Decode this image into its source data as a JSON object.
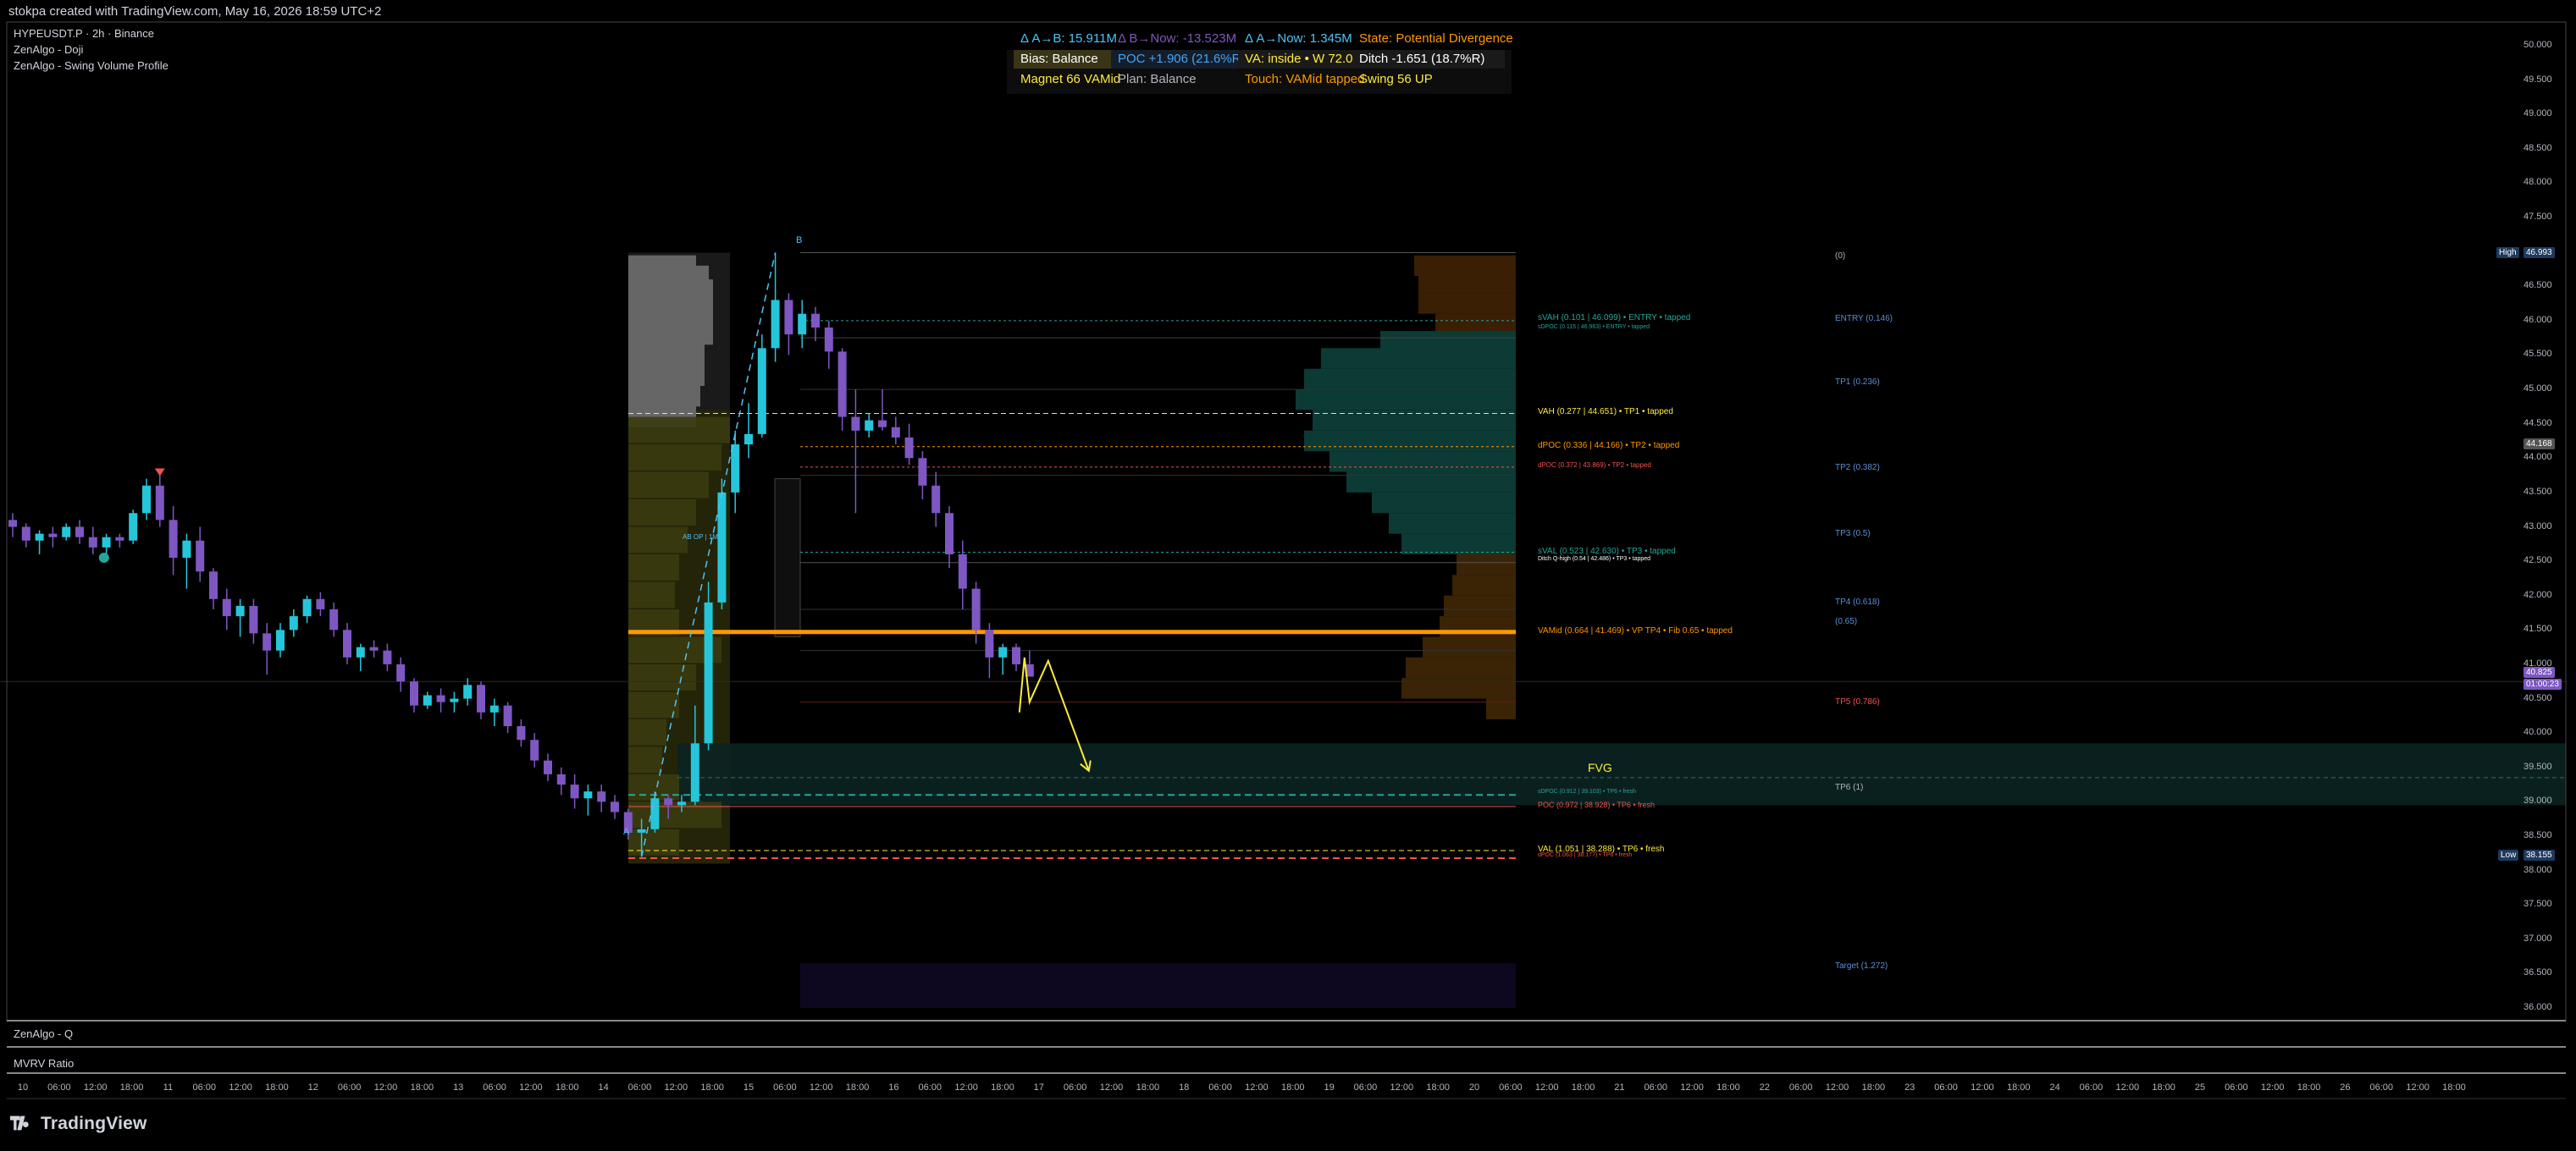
{
  "header": {
    "title": "stokpa created with TradingView.com, May 16, 2026 18:59 UTC+2"
  },
  "legend": [
    "HYPEUSDT.P · 2h · Binance",
    "ZenAlgo - Doji",
    "ZenAlgo - Swing Volume Profile"
  ],
  "stats": {
    "row1": [
      {
        "text": "Δ A→B: 15.911M",
        "color": "#4fc3f7"
      },
      {
        "text": "Δ B→Now: -13.523M",
        "color": "#7e57c2"
      },
      {
        "text": "Δ A→Now: 1.345M",
        "color": "#4fc3f7"
      },
      {
        "text": "State: Potential Divergence",
        "color": "#ff9800"
      }
    ],
    "row2": [
      {
        "text": "Bias: Balance",
        "color": "#ffffff"
      },
      {
        "text": "POC +1.906 (21.6%R)",
        "color": "#42a5f5"
      },
      {
        "text": "VA: inside • W 72.0%R",
        "color": "#ffeb3b"
      },
      {
        "text": "Ditch -1.651 (18.7%R)",
        "color": "#ffffff"
      }
    ],
    "row3": [
      {
        "text": "Magnet 66 VAMid",
        "color": "#ffeb3b"
      },
      {
        "text": "Plan: Balance",
        "color": "#b2b5be"
      },
      {
        "text": "Touch: VAMid tapped",
        "color": "#ff9800"
      },
      {
        "text": "Swing 56 UP",
        "color": "#ffeb3b"
      }
    ]
  },
  "levels": [
    {
      "text": "sVAH (0.101 | 46.099) • ENTRY • tapped",
      "color": "#26a69a"
    },
    {
      "text": "sDPOC (0.115 | 46.963) • ENTRY • tapped",
      "color": "#26a69a"
    },
    {
      "text": "VAH (0.277 | 44.651) • TP1 • tapped",
      "color": "#ffeb3b"
    },
    {
      "text": "dPOC (0.336 | 44.166) • TP2 • tapped",
      "color": "#ff9800"
    },
    {
      "text": "dPOC (0.372 | 43.869) • TP2 • tapped",
      "color": "#ef5350"
    },
    {
      "text": "sVAL (0.523 | 42.630) • TP3 • tapped",
      "color": "#26a69a"
    },
    {
      "text": "Ditch Q-high (0.54 | 42.486) • TP3 • tapped",
      "color": "#ffffff"
    },
    {
      "text": "VAMid (0.664 | 41.469) • VP TP4 • Fib 0.65 • tapped",
      "color": "#ff9800"
    },
    {
      "text": "sDPOC (0.912 | 39.103) • TP6 • fresh",
      "color": "#26a69a"
    },
    {
      "text": "POC (0.972 | 38.928) • TP6 • fresh",
      "color": "#ef5350"
    },
    {
      "text": "VAL (1.051 | 38.288) • TP6 • fresh",
      "color": "#ffeb3b"
    },
    {
      "text": "dPOC (1.063 | 38.177) • TP6 • fresh",
      "color": "#ef5350"
    }
  ],
  "tp_labels": [
    {
      "text": "(0)",
      "color": "#b2b5be"
    },
    {
      "text": "ENTRY (0.146)",
      "color": "#5b8fd6"
    },
    {
      "text": "TP1 (0.236)",
      "color": "#5b8fd6"
    },
    {
      "text": "TP2 (0.382)",
      "color": "#5b8fd6"
    },
    {
      "text": "TP3 (0.5)",
      "color": "#5b8fd6"
    },
    {
      "text": "TP4 (0.618)",
      "color": "#5b8fd6"
    },
    {
      "text": "(0.65)",
      "color": "#5b8fd6"
    },
    {
      "text": "TP5 (0.786)",
      "color": "#ef5350"
    },
    {
      "text": "TP6 (1)",
      "color": "#b2b5be"
    },
    {
      "text": "Target (1.272)",
      "color": "#5b8fd6"
    }
  ],
  "fvg_label": "FVG",
  "point_a": "A",
  "point_b": "B",
  "mini_label": "AB OP | 1M",
  "yaxis": [
    "50.000",
    "49.500",
    "49.000",
    "48.500",
    "48.000",
    "47.500",
    "47.000",
    "46.500",
    "46.000",
    "45.500",
    "45.000",
    "44.500",
    "44.000",
    "43.500",
    "43.000",
    "42.500",
    "42.000",
    "41.500",
    "41.000",
    "40.500",
    "40.000",
    "39.500",
    "39.000",
    "38.500",
    "38.000",
    "37.500",
    "37.000",
    "36.500",
    "36.000"
  ],
  "badges": {
    "high_label": "High",
    "high_value": "46.993",
    "mid_value": "44.168",
    "price_value": "40.825",
    "countdown": "01:00:23",
    "low_label": "Low",
    "low_value": "38.155"
  },
  "xaxis": [
    "10",
    "06:00",
    "12:00",
    "18:00",
    "11",
    "06:00",
    "12:00",
    "18:00",
    "12",
    "06:00",
    "12:00",
    "18:00",
    "13",
    "06:00",
    "12:00",
    "18:00",
    "14",
    "06:00",
    "12:00",
    "18:00",
    "15",
    "06:00",
    "12:00",
    "18:00",
    "16",
    "06:00",
    "12:00",
    "18:00",
    "17",
    "06:00",
    "12:00",
    "18:00",
    "18",
    "06:00",
    "12:00",
    "18:00",
    "19",
    "06:00",
    "12:00",
    "18:00",
    "20",
    "06:00",
    "12:00",
    "18:00",
    "21",
    "06:00",
    "12:00",
    "18:00",
    "22",
    "06:00",
    "12:00",
    "18:00",
    "23",
    "06:00",
    "12:00",
    "18:00",
    "24",
    "06:00",
    "12:00",
    "18:00",
    "25",
    "06:00",
    "12:00",
    "18:00",
    "26",
    "06:00",
    "12:00",
    "18:00"
  ],
  "panes": [
    "ZenAlgo - Q",
    "MVRV Ratio"
  ],
  "brand": "TradingView",
  "chart_data": {
    "type": "candlestick",
    "symbol": "HYPEUSDT.P",
    "timeframe": "2h",
    "ylim": [
      35.6,
      50.3
    ],
    "candles": [
      [
        43.1,
        43.2,
        42.85,
        43.0
      ],
      [
        43.0,
        43.05,
        42.7,
        42.8
      ],
      [
        42.8,
        42.95,
        42.6,
        42.9
      ],
      [
        42.9,
        43.0,
        42.7,
        42.85
      ],
      [
        42.85,
        43.05,
        42.8,
        43.0
      ],
      [
        43.0,
        43.1,
        42.75,
        42.85
      ],
      [
        42.85,
        43.0,
        42.6,
        42.7
      ],
      [
        42.7,
        42.9,
        42.5,
        42.85
      ],
      [
        42.85,
        42.9,
        42.7,
        42.8
      ],
      [
        42.8,
        43.25,
        42.75,
        43.2
      ],
      [
        43.2,
        43.7,
        43.1,
        43.6
      ],
      [
        43.6,
        43.8,
        43.0,
        43.1
      ],
      [
        43.1,
        43.3,
        42.3,
        42.55
      ],
      [
        42.55,
        42.9,
        42.1,
        42.8
      ],
      [
        42.8,
        43.0,
        42.2,
        42.35
      ],
      [
        42.35,
        42.4,
        41.8,
        41.95
      ],
      [
        41.95,
        42.1,
        41.5,
        41.7
      ],
      [
        41.7,
        41.95,
        41.4,
        41.85
      ],
      [
        41.85,
        41.95,
        41.3,
        41.45
      ],
      [
        41.45,
        41.6,
        40.85,
        41.2
      ],
      [
        41.2,
        41.6,
        41.1,
        41.5
      ],
      [
        41.5,
        41.8,
        41.4,
        41.7
      ],
      [
        41.7,
        42.0,
        41.6,
        41.95
      ],
      [
        41.95,
        42.05,
        41.7,
        41.8
      ],
      [
        41.8,
        41.9,
        41.4,
        41.5
      ],
      [
        41.5,
        41.6,
        41.0,
        41.1
      ],
      [
        41.1,
        41.3,
        40.9,
        41.25
      ],
      [
        41.25,
        41.35,
        41.1,
        41.2
      ],
      [
        41.2,
        41.3,
        40.9,
        41.0
      ],
      [
        41.0,
        41.1,
        40.6,
        40.75
      ],
      [
        40.75,
        40.8,
        40.3,
        40.4
      ],
      [
        40.4,
        40.6,
        40.35,
        40.55
      ],
      [
        40.55,
        40.65,
        40.3,
        40.45
      ],
      [
        40.45,
        40.6,
        40.3,
        40.5
      ],
      [
        40.5,
        40.8,
        40.4,
        40.7
      ],
      [
        40.7,
        40.75,
        40.2,
        40.3
      ],
      [
        40.3,
        40.5,
        40.1,
        40.4
      ],
      [
        40.4,
        40.45,
        40.0,
        40.1
      ],
      [
        40.1,
        40.2,
        39.8,
        39.9
      ],
      [
        39.9,
        40.0,
        39.5,
        39.6
      ],
      [
        39.6,
        39.7,
        39.3,
        39.4
      ],
      [
        39.4,
        39.5,
        39.1,
        39.25
      ],
      [
        39.25,
        39.4,
        38.9,
        39.05
      ],
      [
        39.05,
        39.25,
        38.8,
        39.15
      ],
      [
        39.15,
        39.25,
        38.85,
        39.0
      ],
      [
        39.0,
        39.1,
        38.75,
        38.85
      ],
      [
        38.85,
        38.9,
        38.45,
        38.55
      ],
      [
        38.55,
        38.75,
        38.2,
        38.6
      ],
      [
        38.6,
        39.15,
        38.55,
        39.05
      ],
      [
        39.05,
        39.1,
        38.75,
        38.95
      ],
      [
        38.95,
        39.1,
        38.85,
        39.0
      ],
      [
        39.0,
        40.4,
        38.95,
        39.85
      ],
      [
        39.85,
        42.2,
        39.75,
        41.9
      ],
      [
        41.9,
        43.7,
        41.8,
        43.5
      ],
      [
        43.5,
        44.4,
        43.2,
        44.2
      ],
      [
        44.2,
        44.8,
        44.0,
        44.35
      ],
      [
        44.35,
        45.8,
        44.3,
        45.6
      ],
      [
        45.6,
        46.99,
        45.4,
        46.3
      ],
      [
        46.3,
        46.4,
        45.5,
        45.8
      ],
      [
        45.8,
        46.3,
        45.6,
        46.1
      ],
      [
        46.1,
        46.2,
        45.7,
        45.9
      ],
      [
        45.9,
        46.0,
        45.3,
        45.55
      ],
      [
        45.55,
        45.6,
        44.4,
        44.6
      ],
      [
        44.6,
        45.0,
        43.2,
        44.4
      ],
      [
        44.4,
        44.65,
        44.3,
        44.55
      ],
      [
        44.55,
        45.0,
        44.4,
        44.45
      ],
      [
        44.45,
        44.6,
        44.2,
        44.3
      ],
      [
        44.3,
        44.5,
        43.9,
        44.0
      ],
      [
        44.0,
        44.1,
        43.4,
        43.6
      ],
      [
        43.6,
        43.8,
        43.0,
        43.2
      ],
      [
        43.2,
        43.3,
        42.4,
        42.6
      ],
      [
        42.6,
        42.8,
        41.8,
        42.1
      ],
      [
        42.1,
        42.2,
        41.3,
        41.5
      ],
      [
        41.5,
        41.6,
        40.8,
        41.1
      ],
      [
        41.1,
        41.3,
        40.85,
        41.25
      ],
      [
        41.25,
        41.3,
        40.9,
        41.0
      ],
      [
        41.0,
        41.2,
        40.85,
        40.82
      ]
    ],
    "projection": [
      [
        41.0,
        40.3
      ],
      [
        41.1,
        40.9
      ],
      [
        39.3,
        40.1
      ]
    ]
  }
}
